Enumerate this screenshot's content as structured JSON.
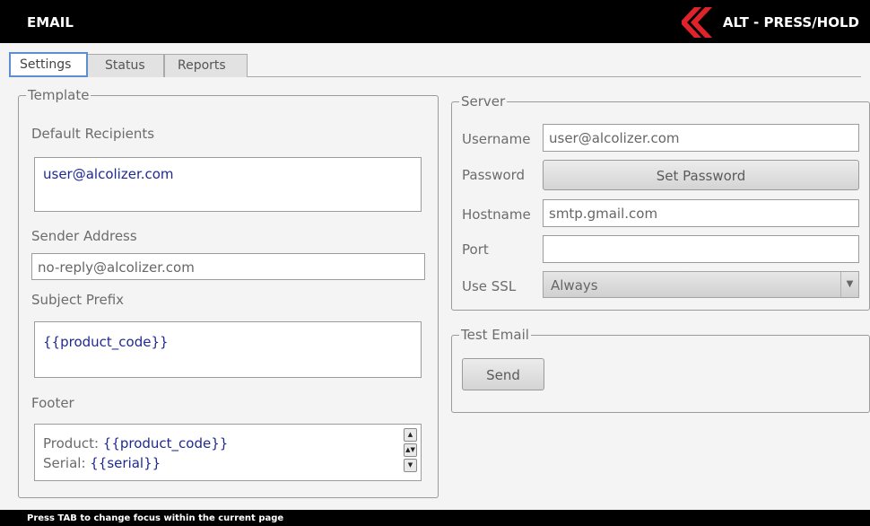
{
  "header": {
    "title": "EMAIL",
    "action_hint": "ALT - PRESS/HOLD",
    "accent_color": "#e0232a"
  },
  "tabs": [
    {
      "label": "Settings",
      "active": true
    },
    {
      "label": "Status",
      "active": false
    },
    {
      "label": "Reports",
      "active": false
    }
  ],
  "template": {
    "legend": "Template",
    "default_recipients_label": "Default Recipients",
    "default_recipients_value": "user@alcolizer.com",
    "sender_address_label": "Sender Address",
    "sender_address_value": "no-reply@alcolizer.com",
    "subject_prefix_label": "Subject Prefix",
    "subject_prefix_value": "{{product_code}}",
    "footer_label": "Footer",
    "footer_lines": [
      {
        "label": "Product: ",
        "value": "{{product_code}}"
      },
      {
        "label": "Serial: ",
        "value": "{{serial}}"
      }
    ]
  },
  "server": {
    "legend": "Server",
    "username_label": "Username",
    "username_value": "user@alcolizer.com",
    "password_label": "Password",
    "set_password_button": "Set Password",
    "hostname_label": "Hostname",
    "hostname_value": "smtp.gmail.com",
    "port_label": "Port",
    "port_value": "",
    "use_ssl_label": "Use SSL",
    "use_ssl_value": "Always"
  },
  "test_email": {
    "legend": "Test Email",
    "send_button": "Send"
  },
  "statusbar": {
    "text": "Press TAB to change focus within the current page"
  }
}
